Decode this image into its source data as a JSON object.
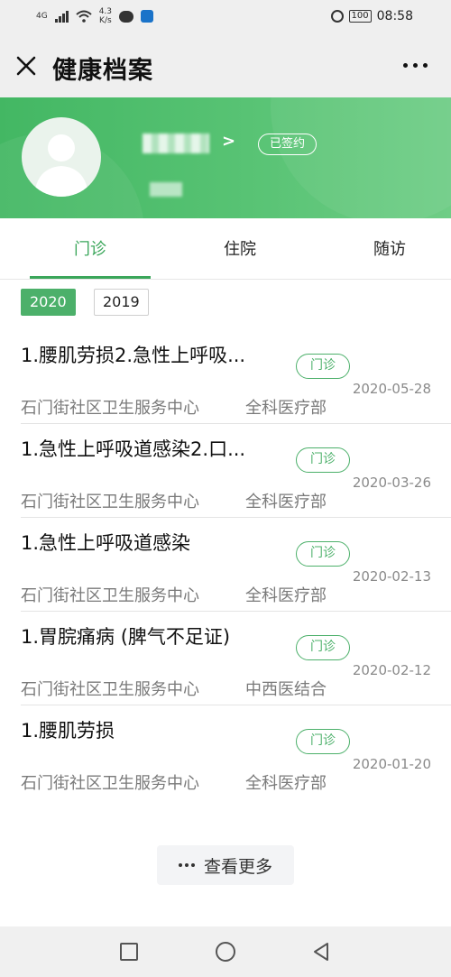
{
  "status_bar": {
    "signal": "4G",
    "speed": "4.3",
    "speed_unit": "K/s",
    "battery": "100",
    "time": "08:58"
  },
  "navbar": {
    "title": "健康档案",
    "close_icon": "close-icon",
    "more_icon": "more-icon"
  },
  "profile": {
    "arrow": ">",
    "badge": "已签约",
    "accent": "#4cb06a"
  },
  "tabs": [
    {
      "label": "门诊",
      "active": true
    },
    {
      "label": "住院",
      "active": false
    },
    {
      "label": "随访",
      "active": false
    }
  ],
  "years": [
    {
      "label": "2020",
      "selected": true
    },
    {
      "label": "2019",
      "selected": false
    }
  ],
  "records": [
    {
      "title": "1.腰肌劳损2.急性上呼吸...",
      "tag": "门诊",
      "date": "2020-05-28",
      "org": "石门街社区卫生服务中心",
      "dept": "全科医疗部"
    },
    {
      "title": "1.急性上呼吸道感染2.口...",
      "tag": "门诊",
      "date": "2020-03-26",
      "org": "石门街社区卫生服务中心",
      "dept": "全科医疗部"
    },
    {
      "title": "1.急性上呼吸道感染",
      "tag": "门诊",
      "date": "2020-02-13",
      "org": "石门街社区卫生服务中心",
      "dept": "全科医疗部"
    },
    {
      "title": "1.胃脘痛病 (脾气不足证)",
      "tag": "门诊",
      "date": "2020-02-12",
      "org": "石门街社区卫生服务中心",
      "dept": "中西医结合"
    },
    {
      "title": "1.腰肌劳损",
      "tag": "门诊",
      "date": "2020-01-20",
      "org": "石门街社区卫生服务中心",
      "dept": "全科医疗部"
    }
  ],
  "more_button": {
    "label": "查看更多"
  }
}
